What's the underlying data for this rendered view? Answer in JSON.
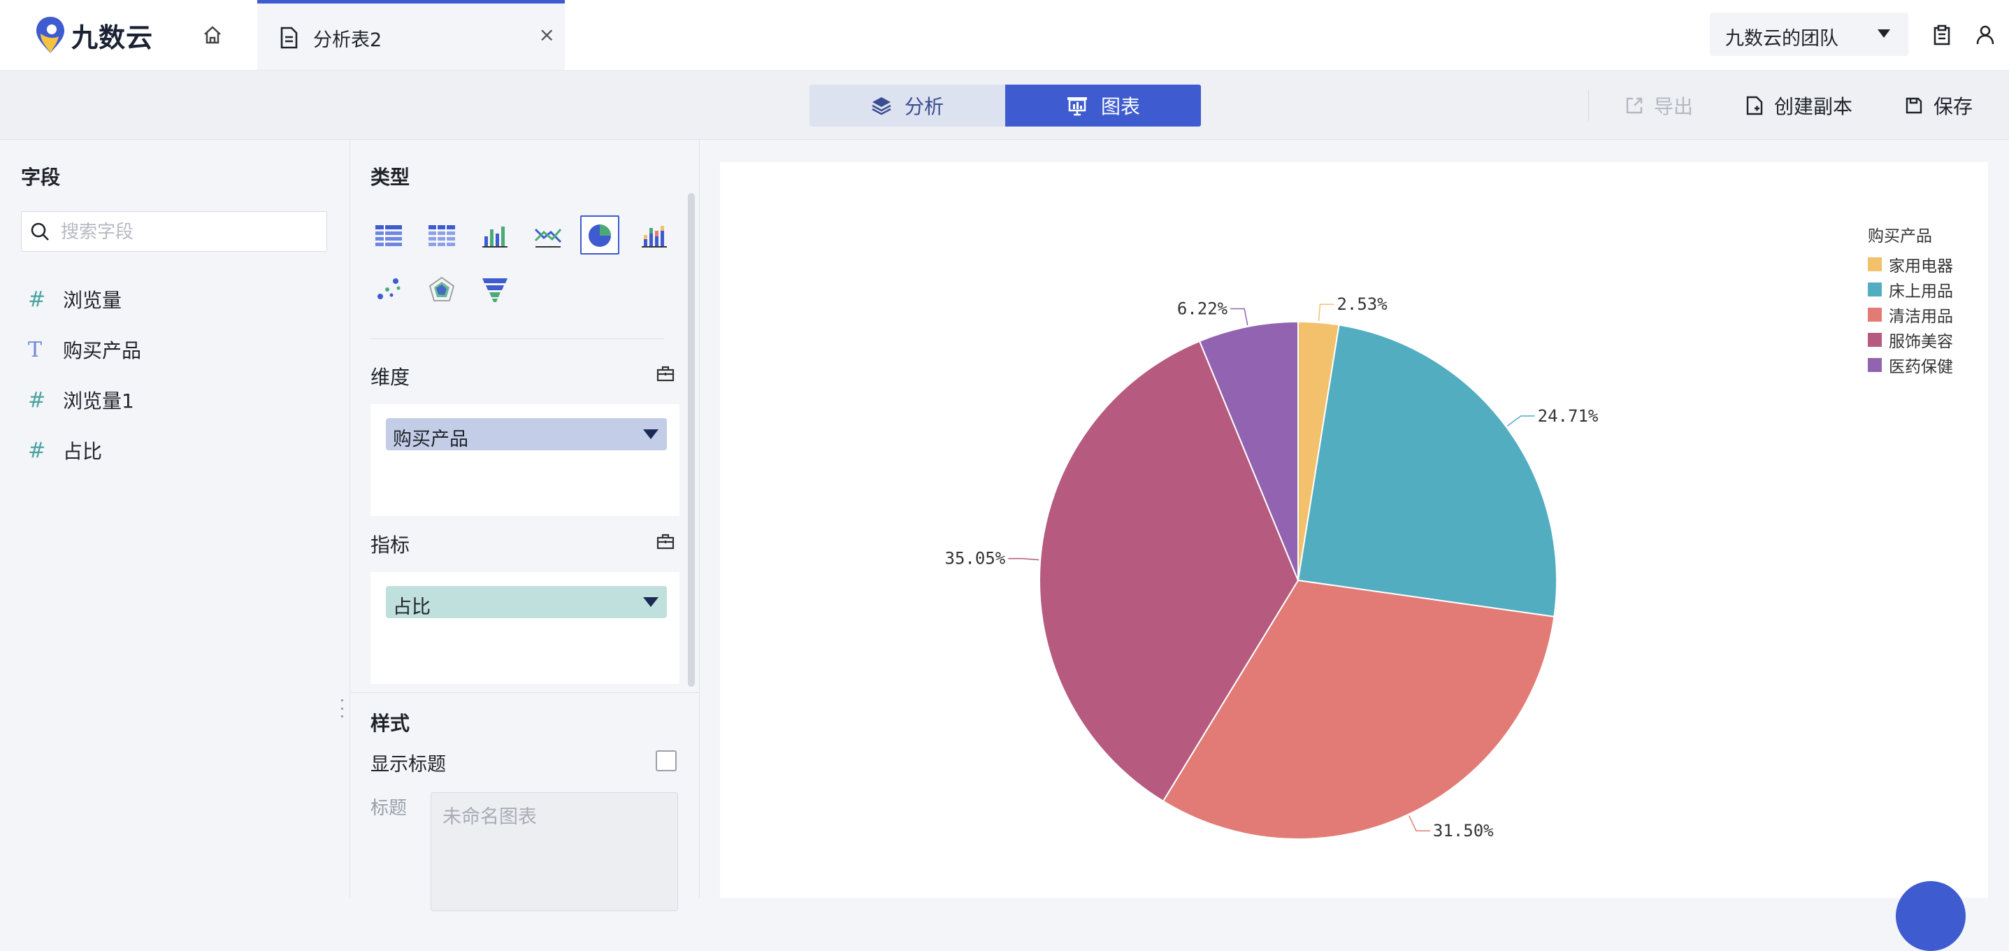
{
  "app": {
    "logo_text": "九数云"
  },
  "tab": {
    "label": "分析表2",
    "close": "×"
  },
  "team": {
    "label": "九数云的团队"
  },
  "toolbar": {
    "analysis_label": "分析",
    "chart_label": "图表",
    "export_label": "导出",
    "copy_label": "创建副本",
    "save_label": "保存"
  },
  "fields": {
    "title": "字段",
    "search_placeholder": "搜索字段",
    "items": [
      {
        "type_symbol": "#",
        "label": "浏览量"
      },
      {
        "type_symbol": "T",
        "label": "购买产品"
      },
      {
        "type_symbol": "#",
        "label": "浏览量1"
      },
      {
        "type_symbol": "#",
        "label": "占比"
      }
    ]
  },
  "config": {
    "type_title": "类型",
    "chart_types": [
      "table-icon",
      "crosstab-icon",
      "bar-chart-icon",
      "line-chart-icon",
      "pie-chart-icon",
      "stacked-bar-icon",
      "scatter-icon",
      "radar-icon",
      "funnel-icon"
    ],
    "active_type": "pie-chart-icon",
    "dimension_title": "维度",
    "dimension_pill": "购买产品",
    "metric_title": "指标",
    "metric_pill": "占比",
    "style_title": "样式",
    "show_title_label": "显示标题",
    "title_label": "标题",
    "title_placeholder": "未命名图表"
  },
  "chart_data": {
    "type": "pie",
    "legend_title": "购买产品",
    "legend_position": "top-right",
    "categories": [
      "家用电器",
      "床上用品",
      "清洁用品",
      "服饰美容",
      "医药保健"
    ],
    "values": [
      2.53,
      24.71,
      31.5,
      35.05,
      6.22
    ],
    "labels": [
      "2.53%",
      "24.71%",
      "31.50%",
      "35.05%",
      "6.22%"
    ],
    "colors": [
      "#f3c06b",
      "#52adc0",
      "#e27b76",
      "#b65a7f",
      "#9163b0"
    ]
  },
  "colors": {
    "accent": "#3e5bd0"
  }
}
